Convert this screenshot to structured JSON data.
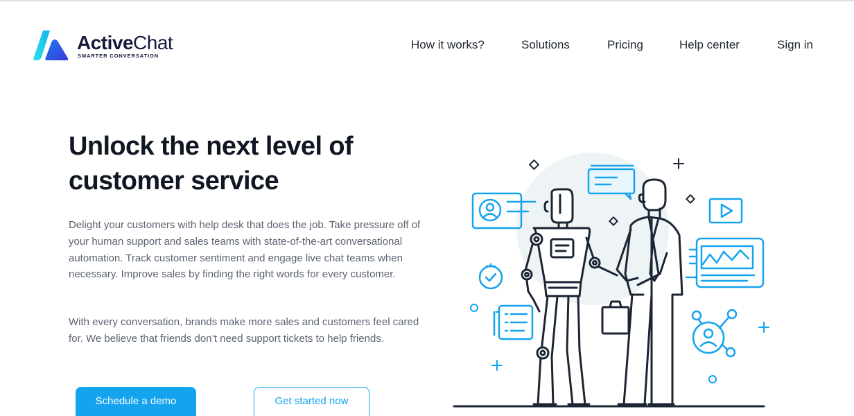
{
  "brand": {
    "name_bold": "Active",
    "name_regular": "Chat",
    "tagline": "SMARTER CONVERSATION"
  },
  "nav": {
    "items": [
      "How it works?",
      "Solutions",
      "Pricing",
      "Help center",
      "Sign in"
    ]
  },
  "hero": {
    "title_line1": "Unlock the next level of",
    "title_line2": "customer service",
    "paragraph1": "Delight your customers with help desk that does the job. Take pressure off of your human support and sales teams with state-of-the-art conversational automation. Track customer sentiment and engage live chat teams when necessary. Improve sales by finding the right words for every customer.",
    "paragraph2": "With every conversation, brands make more sales and customers feel cared for. We believe that friends don’t need support tickets to help friends."
  },
  "buttons": {
    "primary": "Schedule a demo",
    "secondary": "Get started now"
  },
  "colors": {
    "accent": "#14a3ee",
    "dark": "#1b2533",
    "text_muted": "#5b6370",
    "logo_dark": "#131a3a"
  },
  "icons": {
    "logo": "activechat-logo",
    "illustration": "robot-human-handshake-illustration"
  }
}
